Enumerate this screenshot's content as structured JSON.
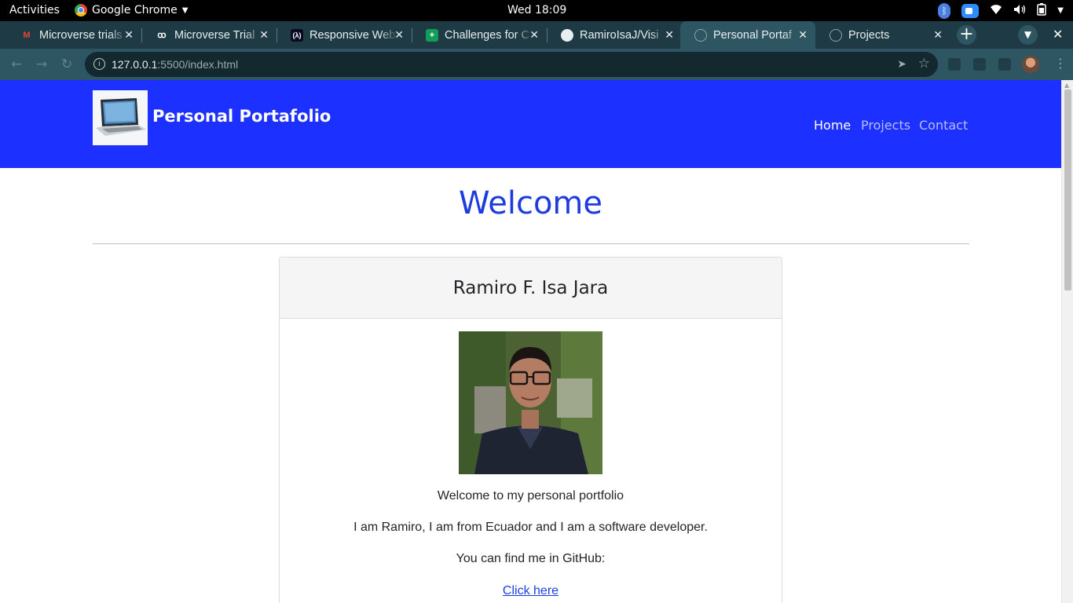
{
  "system_bar": {
    "activities": "Activities",
    "app_name": "Google Chrome",
    "clock": "Wed 18:09"
  },
  "tabs": [
    {
      "title": "Microverse trials",
      "favicon": "gmail-icon",
      "active": false
    },
    {
      "title": "Microverse Trial",
      "favicon": "microverse-icon",
      "active": false
    },
    {
      "title": "Responsive Web",
      "favicon": "freecodecamp-icon",
      "active": false
    },
    {
      "title": "Challenges for C",
      "favicon": "sheets-icon",
      "active": false
    },
    {
      "title": "RamiroIsaJ/Visi",
      "favicon": "github-icon",
      "active": false
    },
    {
      "title": "Personal Portaf",
      "favicon": "globe-icon",
      "active": true
    },
    {
      "title": "Projects",
      "favicon": "globe-icon",
      "active": false
    }
  ],
  "address_bar": {
    "host": "127.0.0.1",
    "path": ":5500/index.html"
  },
  "site": {
    "brand": "Personal Portafolio",
    "nav": {
      "home": "Home",
      "projects": "Projects",
      "contact": "Contact"
    },
    "heading": "Welcome",
    "card": {
      "title": "Ramiro F. Isa Jara",
      "line1": "Welcome to my personal portfolio",
      "line2": "I am Ramiro, I am from Ecuador and I am a software developer.",
      "line3": "You can find me in GitHub:",
      "link": "Click here"
    }
  },
  "colors": {
    "header_bg": "#1c30ff",
    "heading": "#1c3be0",
    "link": "#1a3fe0"
  }
}
